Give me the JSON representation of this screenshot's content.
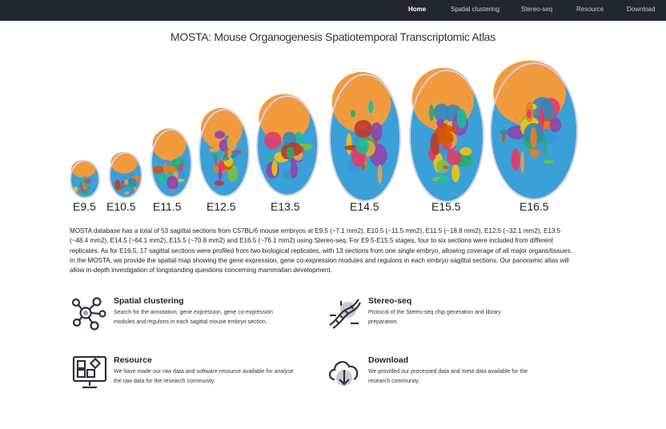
{
  "nav": {
    "items": [
      {
        "label": "Home",
        "active": true
      },
      {
        "label": "Spatial clustering",
        "active": false
      },
      {
        "label": "Stereo-seq",
        "active": false
      },
      {
        "label": "Resource",
        "active": false
      },
      {
        "label": "Download",
        "active": false
      }
    ]
  },
  "page": {
    "title": "MOSTA: Mouse Organogenesis Spatiotemporal Transcriptomic Atlas"
  },
  "figure": {
    "stages": [
      "E9.5",
      "E10.5",
      "E11.5",
      "E12.5",
      "E13.5",
      "E14.5",
      "E15.5",
      "E16.5"
    ],
    "palette": [
      "#f0a040",
      "#2e8bc0",
      "#e23b6b",
      "#7cc242",
      "#8e44ad",
      "#1abc9c",
      "#f1c40f",
      "#e67e22",
      "#c0392b",
      "#27ae60",
      "#3498db",
      "#d35400"
    ]
  },
  "description": "MOSTA database has a total of 53 sagittal sections from C57BL/6 mouse embryos at E9.5 (~7.1 mm2), E10.5 (~11.5 mm2), E11.5 (~18.8 mm2), E12.5 (~32.1 mm2), E13.5 (~48.4 mm2), E14.5 (~64.1 mm2), E15.5 (~70.8 mm2) and E16.5 (~76.1 mm2) using Stereo-seq. For E9.5-E15.5 stages, four to six sections were included from different replicates. As for E16.5, 17 sagittal sections were profiled from two biological replicates, with 13 sections from one single embryo, allowing coverage of all major organs/tissues. In the MOSTA, we provide the spatial map showing the gene expression, gene co-expression modules and regulons in each embryo sagittal sections. Our panoramic atlas will allow in-depth investigation of longstanding questions concerning mammalian development.",
  "features": {
    "spatial": {
      "title": "Spatial clustering",
      "text": "Search for the annotation, gene expression, gene co-expression modules and regulons in each sagittal mouse embryo section.",
      "icon": "spatial-cluster-icon"
    },
    "stereo": {
      "title": "Stereo-seq",
      "text": "Protocol of the Stereo-seq chip generation and library preparation.",
      "icon": "dna-icon"
    },
    "resource": {
      "title": "Resource",
      "text": "We have made our raw data and software resource available for analyse the raw data for the research community.",
      "icon": "monitor-icon"
    },
    "download": {
      "title": "Download",
      "text": "We provided our processed data and meta data available for the research community.",
      "icon": "cloud-download-icon"
    }
  }
}
